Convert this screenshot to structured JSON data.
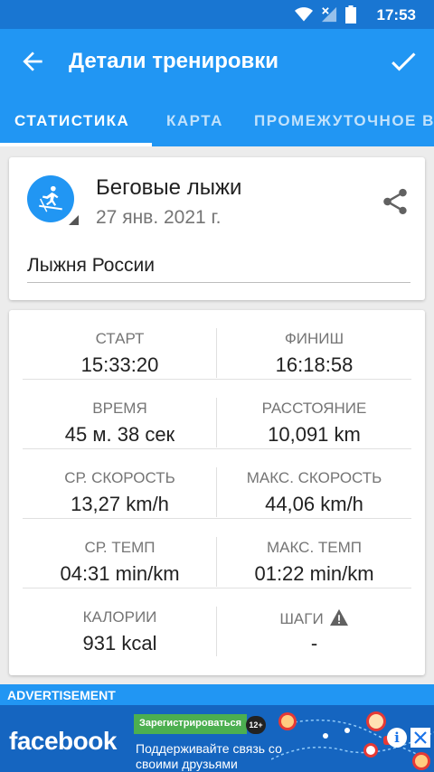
{
  "status_bar": {
    "time": "17:53"
  },
  "app_bar": {
    "title": "Детали тренировки"
  },
  "tabs": [
    {
      "label": "СТАТИСТИКА",
      "active": true
    },
    {
      "label": "КАРТА",
      "active": false
    },
    {
      "label": "ПРОМЕЖУТОЧНОЕ ВРЕМЯ",
      "active": false
    }
  ],
  "workout": {
    "sport_icon": "cross-country-skier-icon",
    "sport": "Беговые лыжи",
    "date": "27 янв. 2021 г.",
    "name": "Лыжня России"
  },
  "stats": [
    {
      "left": {
        "label": "СТАРТ",
        "value": "15:33:20"
      },
      "right": {
        "label": "ФИНИШ",
        "value": "16:18:58"
      }
    },
    {
      "left": {
        "label": "ВРЕМЯ",
        "value": "45 м. 38 сек"
      },
      "right": {
        "label": "РАССТОЯНИЕ",
        "value": "10,091 km"
      }
    },
    {
      "left": {
        "label": "СР. СКОРОСТЬ",
        "value": "13,27 km/h"
      },
      "right": {
        "label": "МАКС. СКОРОСТЬ",
        "value": "44,06 km/h"
      }
    },
    {
      "left": {
        "label": "СР. ТЕМП",
        "value": "04:31 min/km"
      },
      "right": {
        "label": "МАКС. ТЕМП",
        "value": "01:22 min/km"
      }
    },
    {
      "left": {
        "label": "КАЛОРИИ",
        "value": "931 kcal"
      },
      "right": {
        "label": "ШАГИ",
        "value": "-",
        "icon": "warning-icon"
      }
    }
  ],
  "ad": {
    "label": "ADVERTISEMENT",
    "brand": "facebook",
    "cta": "Зарегистрироваться",
    "age_rating": "12+",
    "text": "Поддерживайте связь со своими друзьями"
  },
  "colors": {
    "primary": "#2196f3",
    "primary_dark": "#1976d2",
    "text_primary": "#212121",
    "text_secondary": "#757575"
  }
}
